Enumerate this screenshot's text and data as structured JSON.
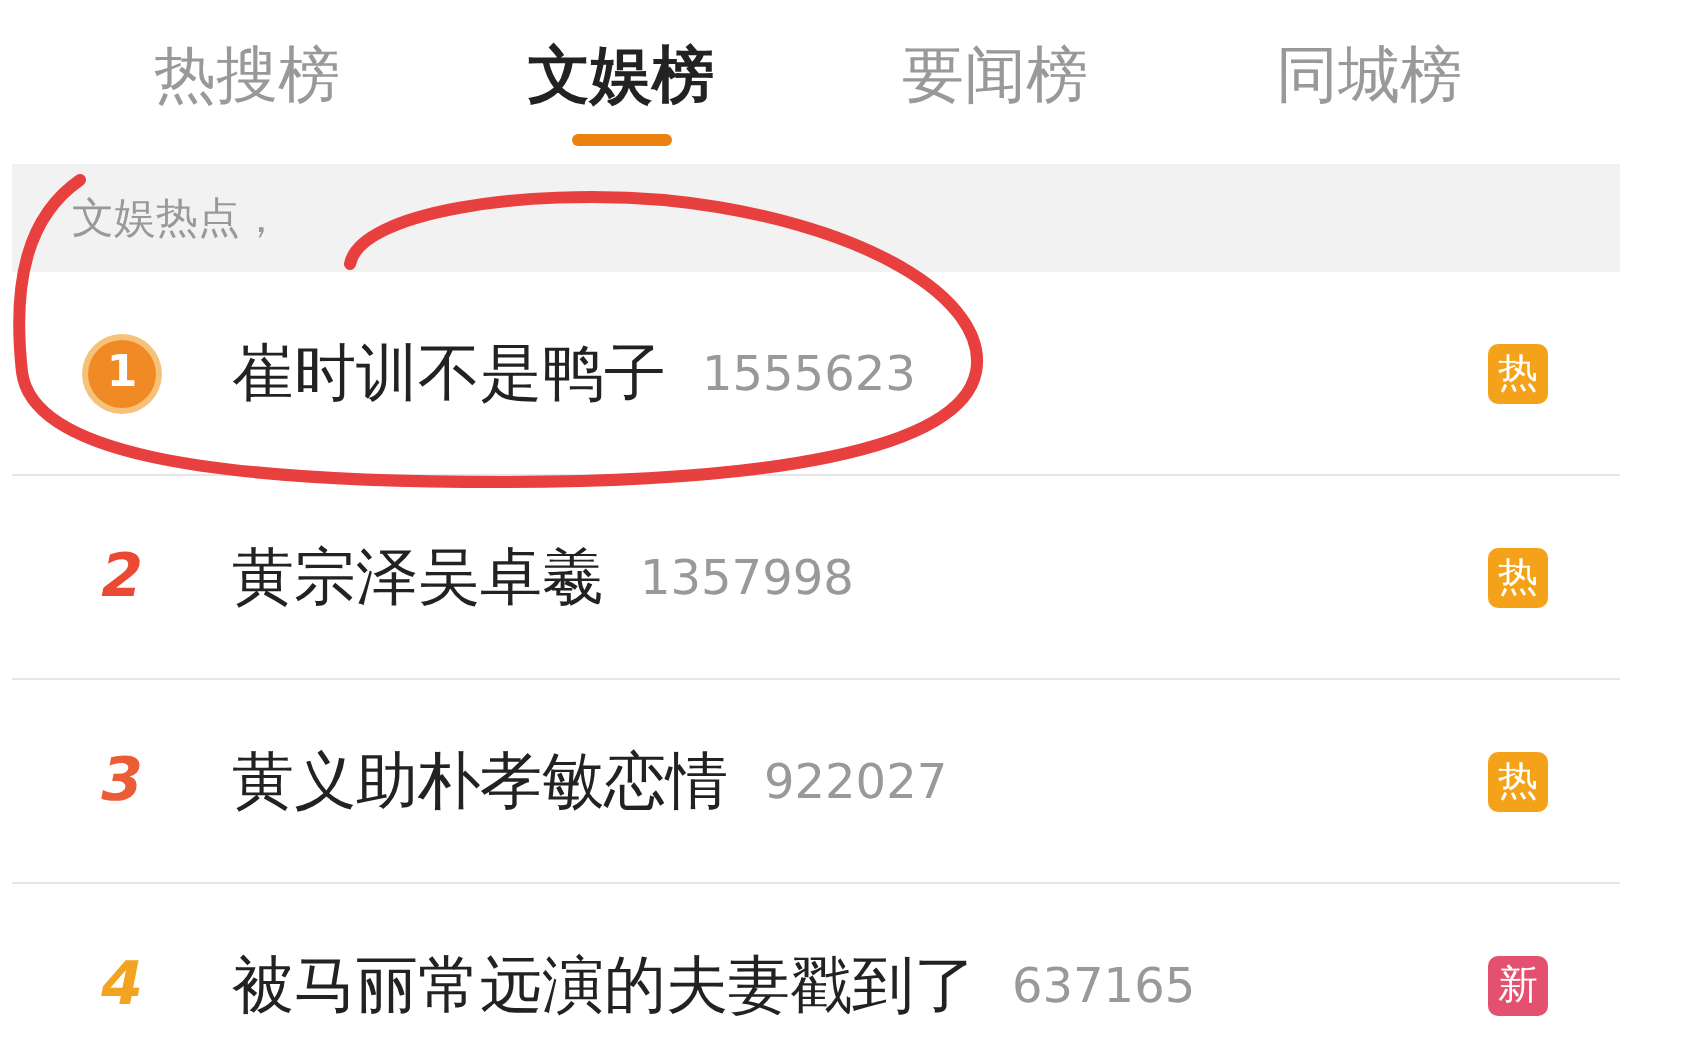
{
  "tabs": [
    {
      "label": "热搜榜",
      "selected": false
    },
    {
      "label": "文娱榜",
      "selected": true
    },
    {
      "label": "要闻榜",
      "selected": false
    },
    {
      "label": "同城榜",
      "selected": false
    }
  ],
  "subtitle": "文娱热点，",
  "rows": [
    {
      "rank": "1",
      "kind": "medal",
      "color": "#f08a24",
      "title": "崔时训不是鸭子",
      "count": "1555623",
      "badge": {
        "kind": "hot",
        "label": "热"
      }
    },
    {
      "rank": "2",
      "kind": "number",
      "color": "#ea4a34",
      "title": "黄宗泽吴卓羲",
      "count": "1357998",
      "badge": {
        "kind": "hot",
        "label": "热"
      }
    },
    {
      "rank": "3",
      "kind": "number",
      "color": "#ea5d36",
      "title": "黄义助朴孝敏恋情",
      "count": "922027",
      "badge": {
        "kind": "hot",
        "label": "热"
      }
    },
    {
      "rank": "4",
      "kind": "number",
      "color": "#f2a321",
      "title": "被马丽常远演的夫妻戳到了",
      "count": "637165",
      "badge": {
        "kind": "new",
        "label": "新"
      }
    }
  ]
}
